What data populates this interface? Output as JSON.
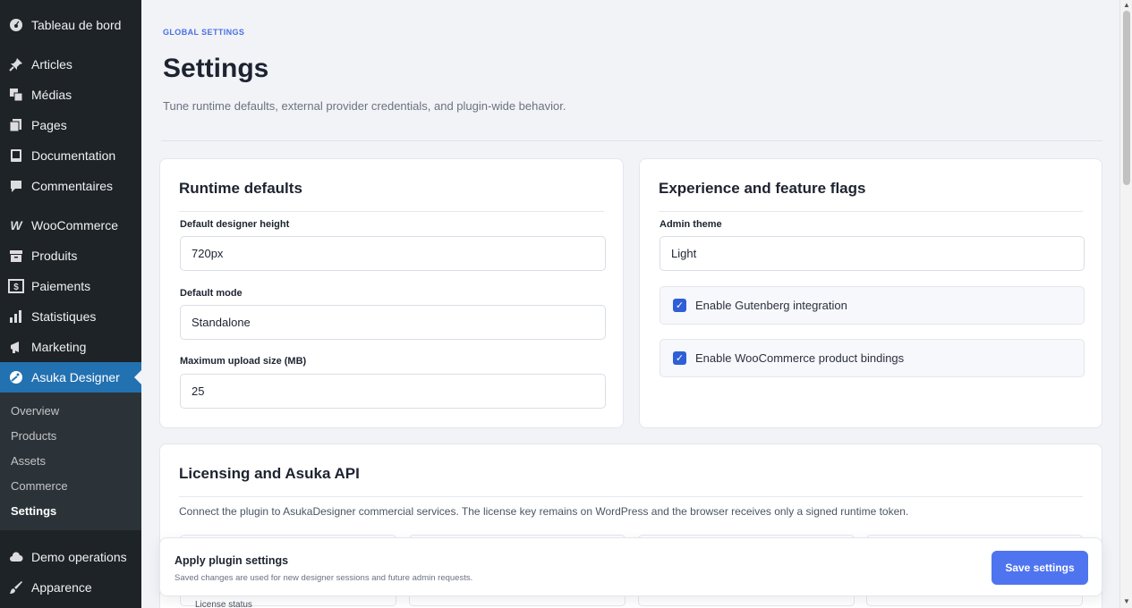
{
  "sidebar": {
    "items": [
      {
        "label": "Tableau de bord",
        "icon": "dashboard-icon"
      },
      {
        "label": "Articles",
        "icon": "pin-icon"
      },
      {
        "label": "Médias",
        "icon": "media-icon"
      },
      {
        "label": "Pages",
        "icon": "pages-icon"
      },
      {
        "label": "Documentation",
        "icon": "book-icon"
      },
      {
        "label": "Commentaires",
        "icon": "comment-icon"
      },
      {
        "label": "WooCommerce",
        "icon": "woo-icon"
      },
      {
        "label": "Produits",
        "icon": "archive-icon"
      },
      {
        "label": "Paiements",
        "icon": "dollar-icon"
      },
      {
        "label": "Statistiques",
        "icon": "chart-bar-icon"
      },
      {
        "label": "Marketing",
        "icon": "megaphone-icon"
      },
      {
        "label": "Asuka Designer",
        "icon": "palette-icon"
      },
      {
        "label": "Demo operations",
        "icon": "cloud-icon"
      },
      {
        "label": "Apparence",
        "icon": "brush-icon"
      }
    ],
    "submenu": [
      "Overview",
      "Products",
      "Assets",
      "Commerce",
      "Settings"
    ]
  },
  "header": {
    "eyebrow": "GLOBAL SETTINGS",
    "title": "Settings",
    "subtitle": "Tune runtime defaults, external provider credentials, and plugin-wide behavior."
  },
  "runtime": {
    "title": "Runtime defaults",
    "height_label": "Default designer height",
    "height_value": "720px",
    "mode_label": "Default mode",
    "mode_value": "Standalone",
    "upload_label": "Maximum upload size (MB)",
    "upload_value": "25"
  },
  "experience": {
    "title": "Experience and feature flags",
    "theme_label": "Admin theme",
    "theme_value": "Light",
    "gutenberg_label": "Enable Gutenberg integration",
    "woocommerce_label": "Enable WooCommerce product bindings"
  },
  "licensing": {
    "title": "Licensing and Asuka API",
    "description": "Connect the plugin to AsukaDesigner commercial services. The license key remains on WordPress and the browser receives only a signed runtime token.",
    "status_label": "License status"
  },
  "apply": {
    "title": "Apply plugin settings",
    "description": "Saved changes are used for new designer sessions and future admin requests.",
    "save_label": "Save settings"
  },
  "colors": {
    "accent": "#4f74f0",
    "sidebar_bg": "#1d2327",
    "active_menu": "#2271b1"
  }
}
